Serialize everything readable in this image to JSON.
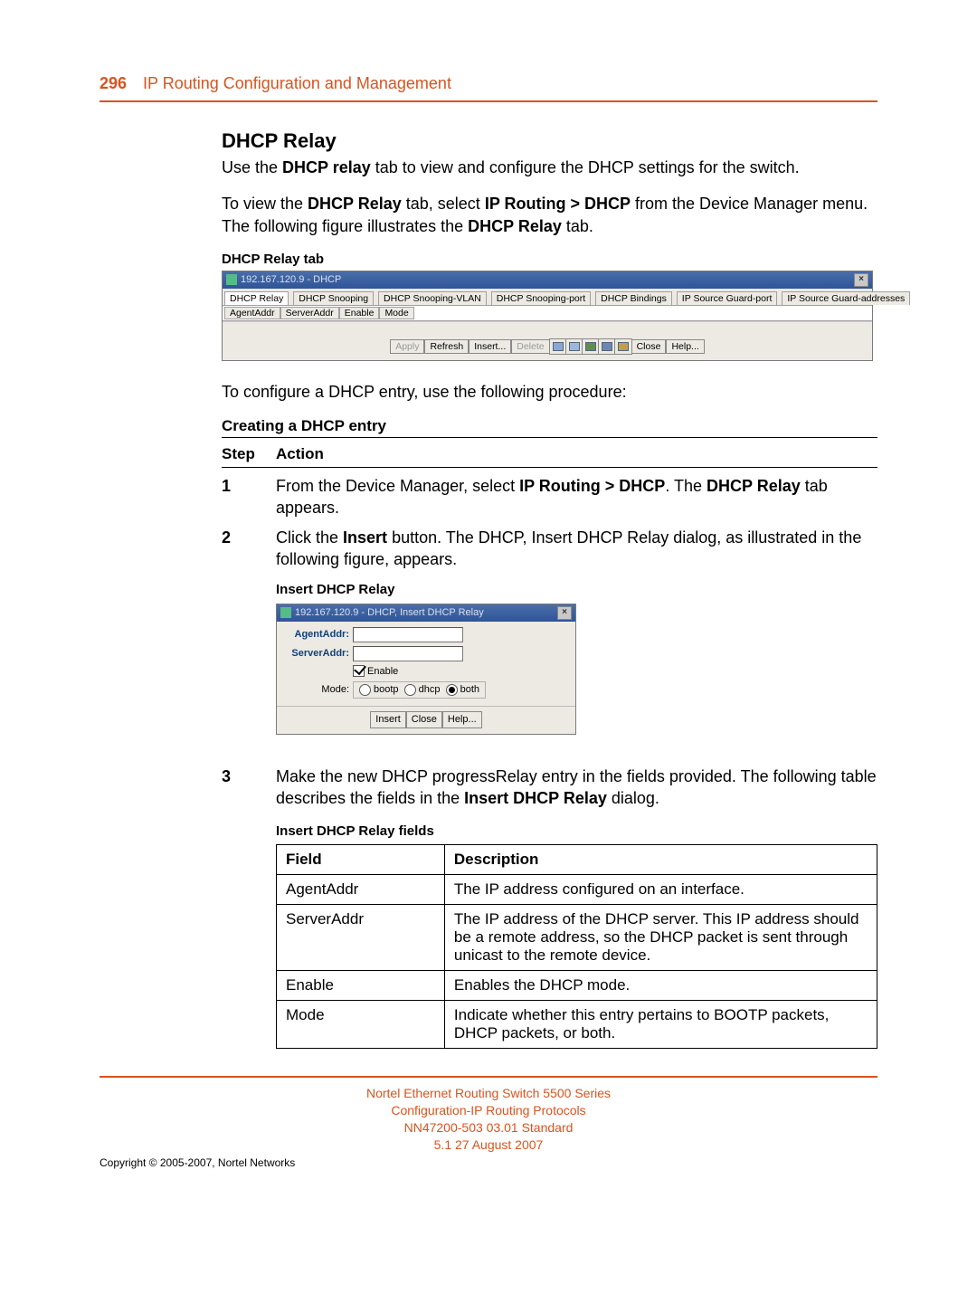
{
  "header": {
    "page_no": "296",
    "chapter": "IP Routing Configuration and Management"
  },
  "section": {
    "title": "DHCP Relay",
    "para1a": "Use the ",
    "para1b": "DHCP relay",
    "para1c": " tab to view and configure the DHCP settings for the switch.",
    "para2a": "To view the ",
    "para2b": "DHCP Relay",
    "para2c": " tab, select ",
    "para2d": "IP Routing > DHCP",
    "para2e": " from the Device Manager menu. The following figure illustrates the ",
    "para2f": "DHCP Relay",
    "para2g": " tab.",
    "fig1_caption": "DHCP Relay tab",
    "para_after_fig1": "To configure a DHCP entry, use the following procedure:",
    "proc_title": "Creating a DHCP entry",
    "proc_step": "Step",
    "proc_action": "Action",
    "step1_num": "1",
    "step1a": "From the Device Manager, select ",
    "step1b": "IP Routing > DHCP",
    "step1c": ". The ",
    "step1d": "DHCP Relay",
    "step1e": " tab appears.",
    "step2_num": "2",
    "step2a": "Click the ",
    "step2b": "Insert",
    "step2c": " button. The DHCP, Insert DHCP Relay dialog, as illustrated in the following figure, appears.",
    "fig2_caption": "Insert DHCP Relay",
    "step3_num": "3",
    "step3a": "Make the new DHCP progressRelay entry in the fields provided. The following table describes the fields in the ",
    "step3b": "Insert DHCP Relay",
    "step3c": " dialog.",
    "fields_caption": "Insert DHCP Relay fields"
  },
  "screenshot1": {
    "title": "192.167.120.9 - DHCP",
    "tabs": [
      "DHCP Relay",
      "DHCP Snooping",
      "DHCP Snooping-VLAN",
      "DHCP Snooping-port",
      "DHCP Bindings",
      "IP Source Guard-port",
      "IP Source Guard-addresses"
    ],
    "cols": [
      "AgentAddr",
      "ServerAddr",
      "Enable",
      "Mode"
    ],
    "btns": {
      "apply": "Apply",
      "refresh": "Refresh",
      "insert": "Insert...",
      "delete": "Delete",
      "close": "Close",
      "help": "Help..."
    }
  },
  "screenshot2": {
    "title": "192.167.120.9 - DHCP, Insert DHCP Relay",
    "labels": {
      "agent": "AgentAddr:",
      "server": "ServerAddr:",
      "mode": "Mode:",
      "enable": "Enable"
    },
    "radios": {
      "bootp": "bootp",
      "dhcp": "dhcp",
      "both": "both"
    },
    "btns": {
      "insert": "Insert",
      "close": "Close",
      "help": "Help..."
    }
  },
  "fields_table": {
    "h1": "Field",
    "h2": "Description",
    "rows": [
      {
        "f": "AgentAddr",
        "d": "The IP address configured on an interface."
      },
      {
        "f": "ServerAddr",
        "d": "The IP address of the DHCP server. This IP address should be a remote address, so the DHCP packet is sent through unicast to the remote device."
      },
      {
        "f": "Enable",
        "d": "Enables the DHCP mode."
      },
      {
        "f": "Mode",
        "d": "Indicate whether this entry pertains to BOOTP packets, DHCP packets, or both."
      }
    ]
  },
  "footer": {
    "l1": "Nortel Ethernet Routing Switch 5500 Series",
    "l2": "Configuration-IP Routing Protocols",
    "l3": "NN47200-503   03.01   Standard",
    "l4": "5.1   27 August 2007",
    "copyright": "Copyright © 2005-2007, Nortel Networks"
  }
}
